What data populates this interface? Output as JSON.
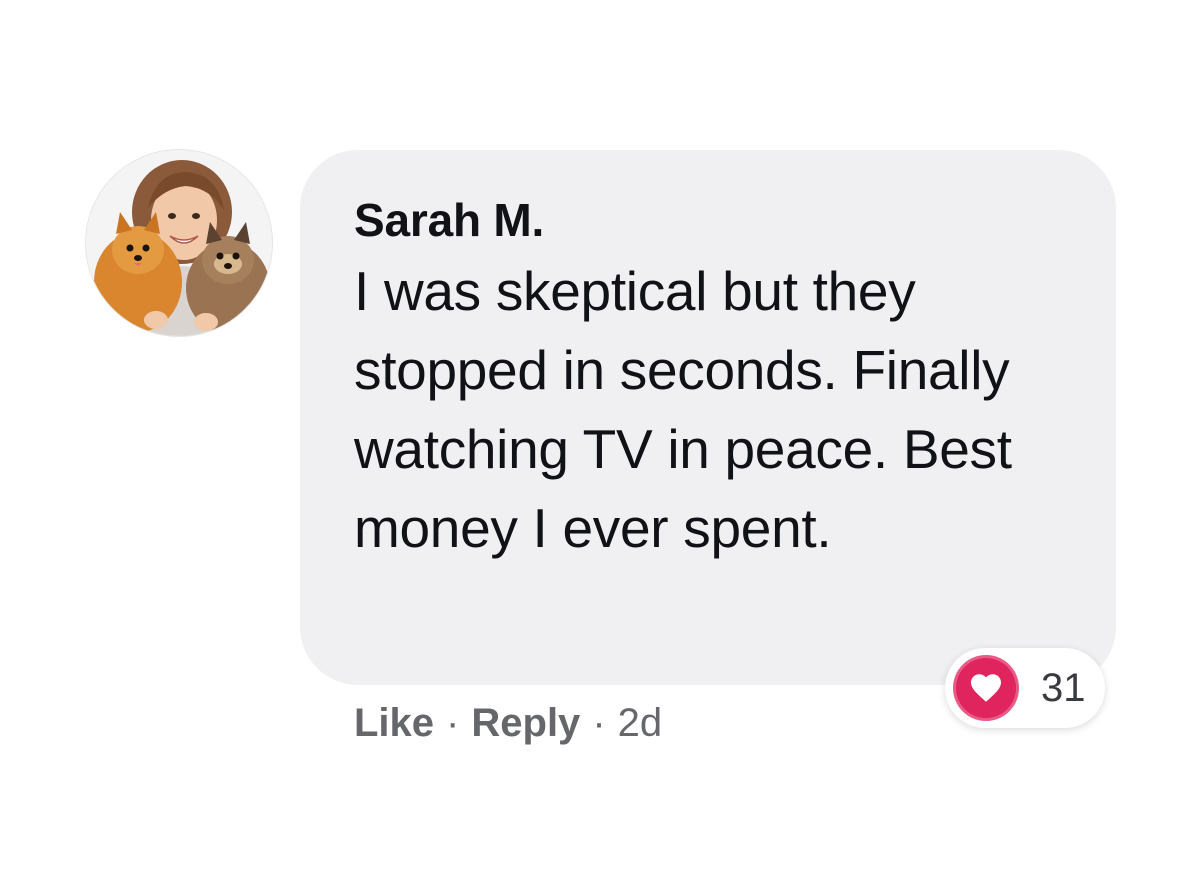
{
  "comment": {
    "author": "Sarah M.",
    "text": "I was skeptical but they stopped in seconds. Finally watching TV in peace. Best money I ever spent.",
    "avatar_icon": "profile-photo-woman-with-pomeranians",
    "actions": {
      "like_label": "Like",
      "reply_label": "Reply",
      "separator": "·",
      "timestamp": "2d"
    },
    "reactions": {
      "icon": "heart-icon",
      "count": "31",
      "color": "#e0245e"
    }
  },
  "colors": {
    "bubble": "#f0f0f2",
    "text": "#111217",
    "secondary_text": "#65676b"
  }
}
